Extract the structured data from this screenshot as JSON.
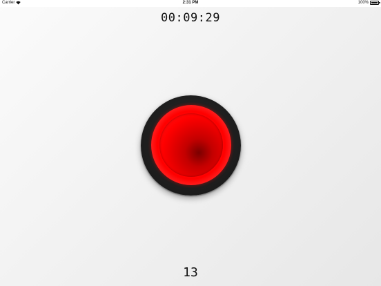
{
  "status_bar": {
    "carrier": "Carrier",
    "wifi_icon": "wifi-icon",
    "time": "2:31 PM",
    "battery_percent": "100%",
    "battery_level": 1.0,
    "battery_icon": "battery-icon"
  },
  "timer": {
    "elapsed": "00:09:29"
  },
  "record_button": {
    "icon": "record-icon",
    "color": "#ff0000",
    "bezel_color": "#1c1c1c"
  },
  "counter": {
    "value": "13"
  }
}
